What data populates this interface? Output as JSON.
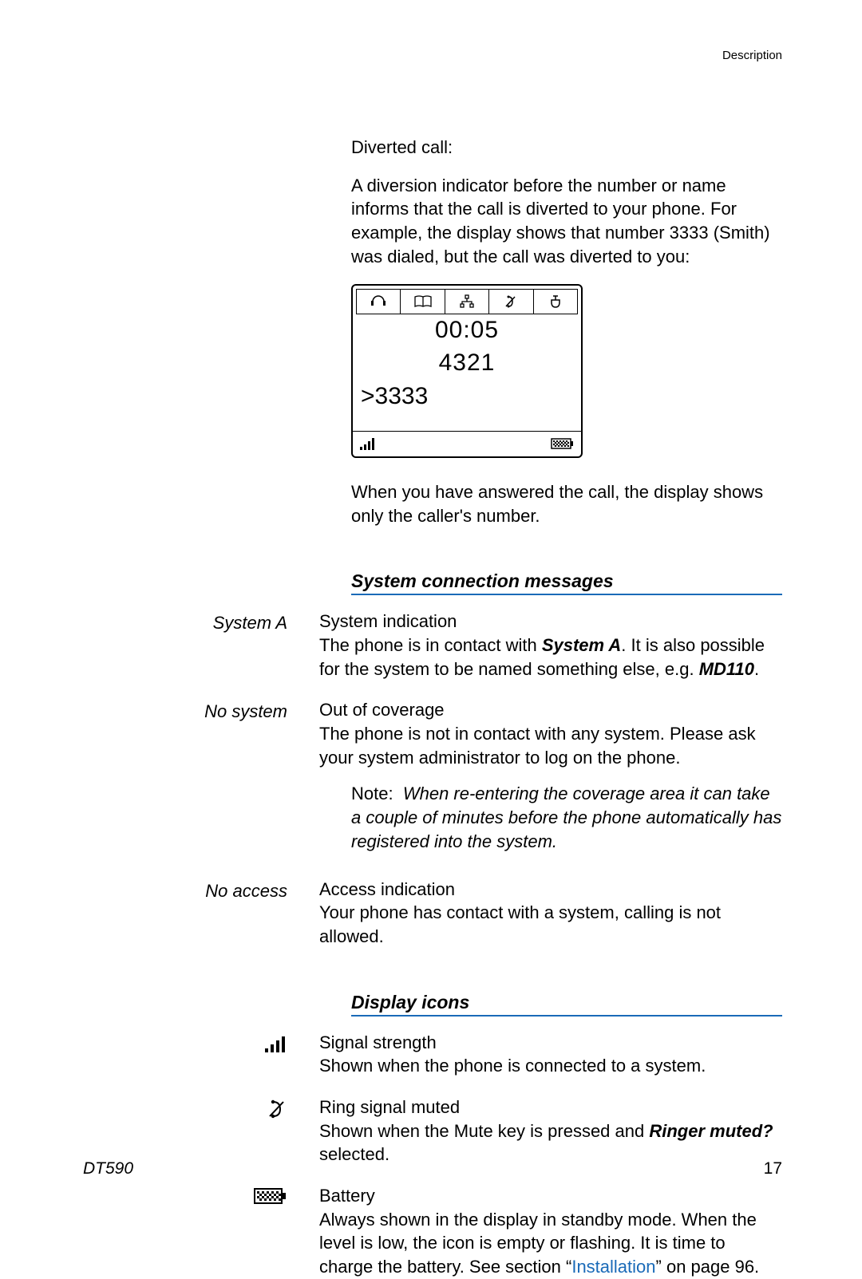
{
  "header_right": "Description",
  "diverted": {
    "title": "Diverted call:",
    "body": "A diversion indicator before the number or name informs that the call is diverted to your phone. For example, the display shows that number 3333 (Smith) was dialed, but the call was diverted to you:"
  },
  "phone": {
    "time": "00:05",
    "number": "4321",
    "caller": ">3333"
  },
  "after_phone": "When you have answered the call, the display shows only the caller's number.",
  "section1": {
    "heading": "System connection messages",
    "items": [
      {
        "left": "System A",
        "title": "System indication",
        "body_pre": "The phone is in contact with ",
        "body_bold1": "System A",
        "body_mid": ". It is also possible for the system to be named something else, e.g. ",
        "body_bold2": "MD110",
        "body_post": "."
      },
      {
        "left": "No system",
        "title": "Out of coverage",
        "body": "The phone is not in contact with any system. Please ask your system administrator to log on the phone.",
        "note_label": "Note:",
        "note": "When re-entering the coverage area it can take a couple of minutes before the phone automatically has registered into the system."
      },
      {
        "left": "No access",
        "title": "Access indication",
        "body": "Your phone has contact with a system, calling is not allowed."
      }
    ]
  },
  "section2": {
    "heading": "Display icons",
    "items": [
      {
        "icon": "signal",
        "title": "Signal strength",
        "body": "Shown when the phone is connected to a system."
      },
      {
        "icon": "mute",
        "title": "Ring signal muted",
        "body_pre": "Shown when the Mute key is pressed and ",
        "body_bold": "Ringer muted?",
        "body_post": " selected."
      },
      {
        "icon": "battery",
        "title": "Battery",
        "body_pre": "Always shown in the display in standby mode. When the level is low, the icon is empty or flashing. It is time to charge the battery. See section “",
        "link": "Installation",
        "body_post": "” on page 96."
      }
    ]
  },
  "footer": {
    "model": "DT590",
    "page": "17"
  }
}
